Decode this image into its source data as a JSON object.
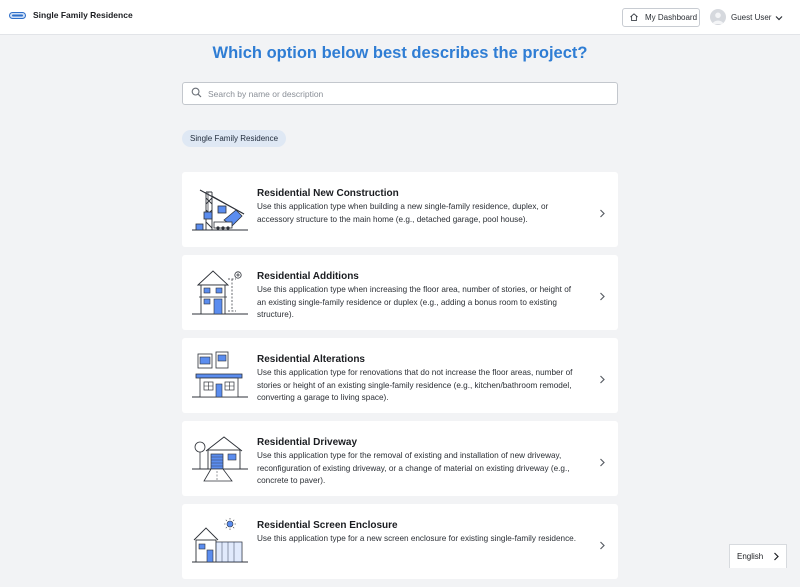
{
  "header": {
    "brand_name": "Single Family Residence",
    "dashboard_label": "My Dashboard",
    "user_name": "Guest User"
  },
  "main": {
    "heading": "Which option below best describes the project?",
    "search_placeholder": "Search by name or description",
    "category_chip": "Single Family Residence",
    "options": [
      {
        "icon": "construction-crane-icon",
        "title": "Residential New Construction",
        "description": "Use this application type when building a new single-family residence, duplex, or accessory structure to the main home (e.g., detached garage, pool house)."
      },
      {
        "icon": "house-addition-icon",
        "title": "Residential Additions",
        "description": "Use this application type when increasing the floor area, number of stories, or height of an existing single-family residence or duplex (e.g., adding a bonus room to existing structure)."
      },
      {
        "icon": "house-alteration-icon",
        "title": "Residential Alterations",
        "description": "Use this application type for renovations that do not increase the floor areas, number of stories or height of an existing single-family residence (e.g., kitchen/bathroom remodel, converting a garage to living space)."
      },
      {
        "icon": "driveway-icon",
        "title": "Residential Driveway",
        "description": "Use this application type for the removal of existing and installation of new driveway, reconfiguration of existing driveway, or a change of material on existing driveway (e.g., concrete to paver)."
      },
      {
        "icon": "screen-enclosure-icon",
        "title": "Residential Screen Enclosure",
        "description": "Use this application type for a new screen enclosure for existing single-family residence."
      }
    ]
  },
  "language": {
    "label": "English"
  },
  "colors": {
    "accent": "#2f7dd4",
    "page_bg": "#f2f3f5",
    "chip_bg": "#dfe8f4",
    "icon_blue": "#5b8def"
  }
}
